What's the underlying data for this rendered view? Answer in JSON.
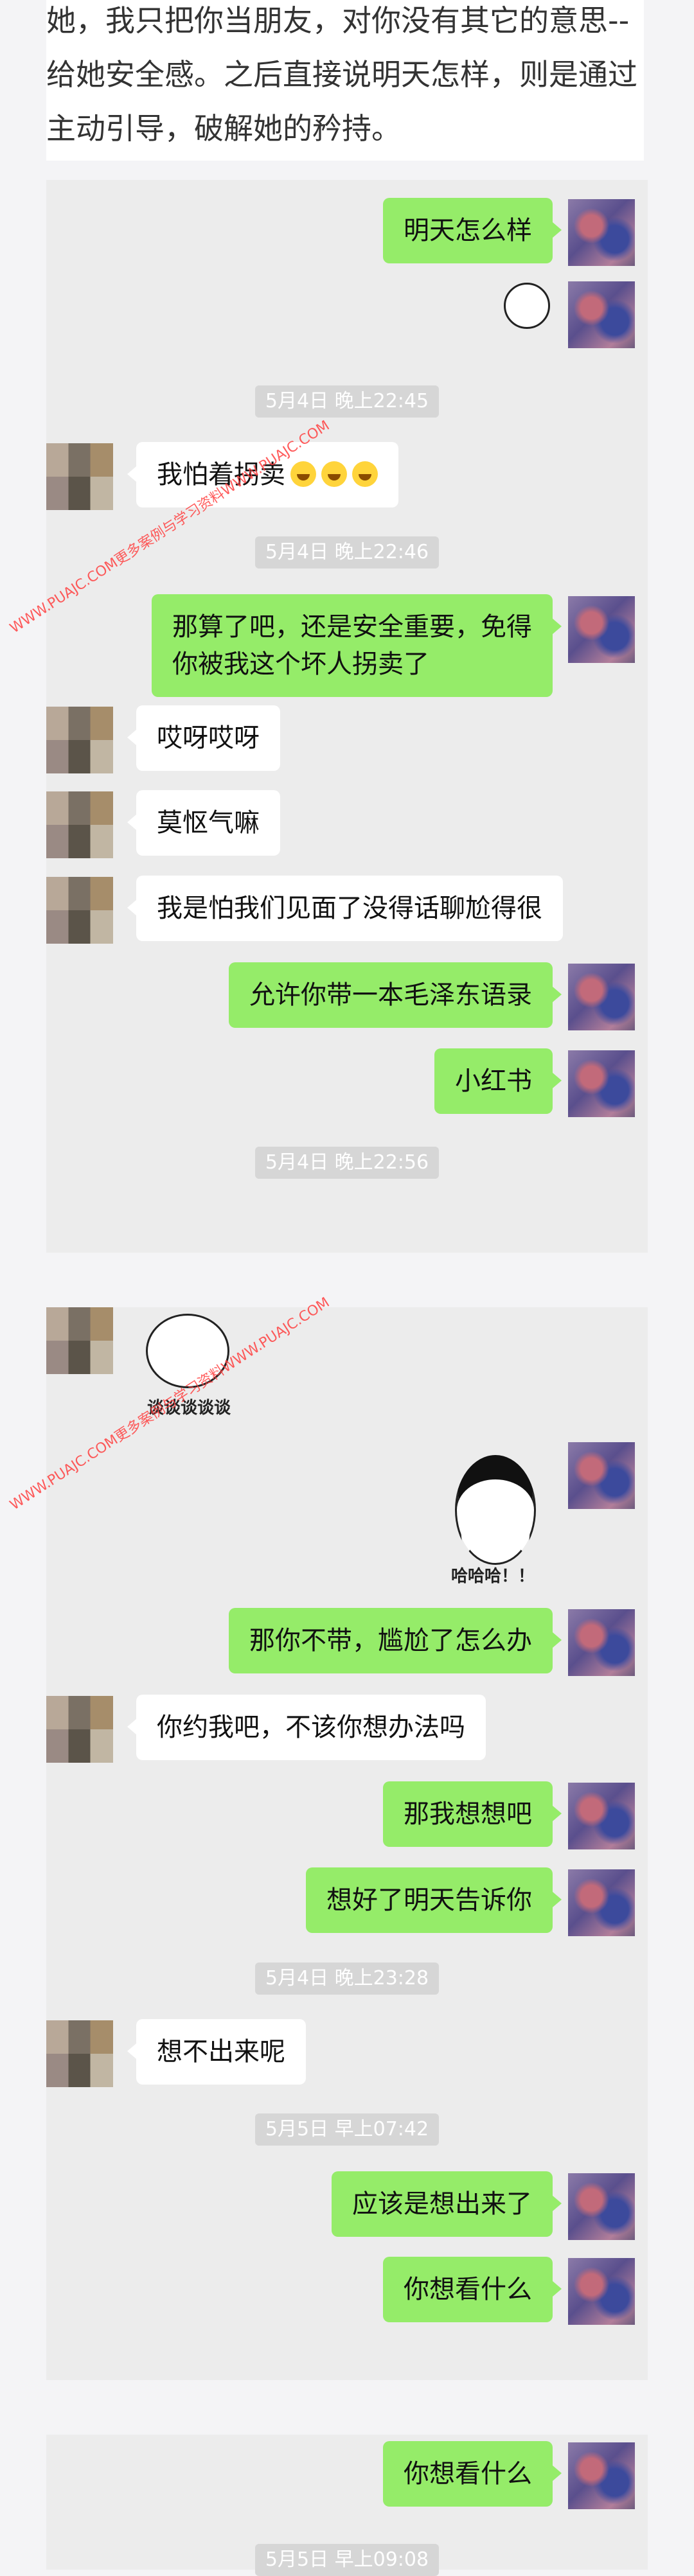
{
  "article": {
    "text": "她，我只把你当朋友，对你没有其它的意思--给她安全感。之后直接说明天怎样，则是通过主动引导，破解她的矜持。"
  },
  "watermark": "WWW.PUAJC.COM更多案例与学习资料WWW.PUAJC.COM",
  "chat1": {
    "msg_tomorrow": "明天怎么样",
    "time1": "5月4日 晚上22:45",
    "msg_afraid": "我怕着拐卖",
    "time2": "5月4日 晚上22:46",
    "msg_forget": "那算了吧，还是安全重要，免得你被我这个坏人拐卖了",
    "msg_aiya": "哎呀哎呀",
    "msg_angry": "莫怄气嘛",
    "msg_nothing_to_say": "我是怕我们见面了没得话聊尬得很",
    "msg_allow_book": "允许你带一本毛泽东语录",
    "msg_red_book": "小红书",
    "time3": "5月4日 晚上22:56"
  },
  "chat2": {
    "sticker_talk": "谈谈谈谈谈",
    "sticker_laugh": "哈哈哈！！",
    "msg_if_not": "那你不带，尴尬了怎么办",
    "msg_you_asked": "你约我吧，不该你想办法吗",
    "msg_let_me_think": "那我想想吧",
    "msg_tell_tomorrow": "想好了明天告诉你",
    "time4": "5月4日 晚上23:28",
    "msg_cant_think": "想不出来呢",
    "time5": "5月5日 早上07:42",
    "msg_should_have": "应该是想出来了",
    "msg_what_watch": "你想看什么"
  },
  "chat3": {
    "msg_what_watch": "你想看什么",
    "time6": "5月5日 早上09:08"
  }
}
